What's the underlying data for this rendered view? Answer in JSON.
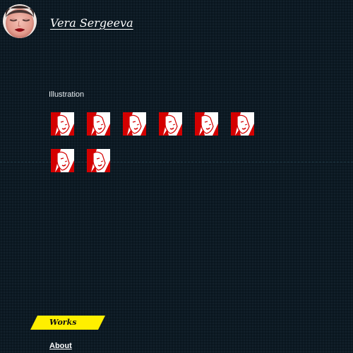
{
  "header": {
    "site_title": "Vera Sergeeva",
    "avatar_icon": "avatar-face-icon"
  },
  "main": {
    "section_heading": "Illustration",
    "thumbnails": [
      {
        "icon": "illustration-thumbnail-icon"
      },
      {
        "icon": "illustration-thumbnail-icon"
      },
      {
        "icon": "illustration-thumbnail-icon"
      },
      {
        "icon": "illustration-thumbnail-icon"
      },
      {
        "icon": "illustration-thumbnail-icon"
      },
      {
        "icon": "illustration-thumbnail-icon"
      },
      {
        "icon": "illustration-thumbnail-icon"
      },
      {
        "icon": "illustration-thumbnail-icon"
      }
    ]
  },
  "nav": {
    "works_label": "Works",
    "about_label": "About",
    "active_color": "#ffef00"
  },
  "colors": {
    "background": "#0c1a24",
    "thumbnail_red": "#d40000",
    "text": "#ffffff"
  }
}
